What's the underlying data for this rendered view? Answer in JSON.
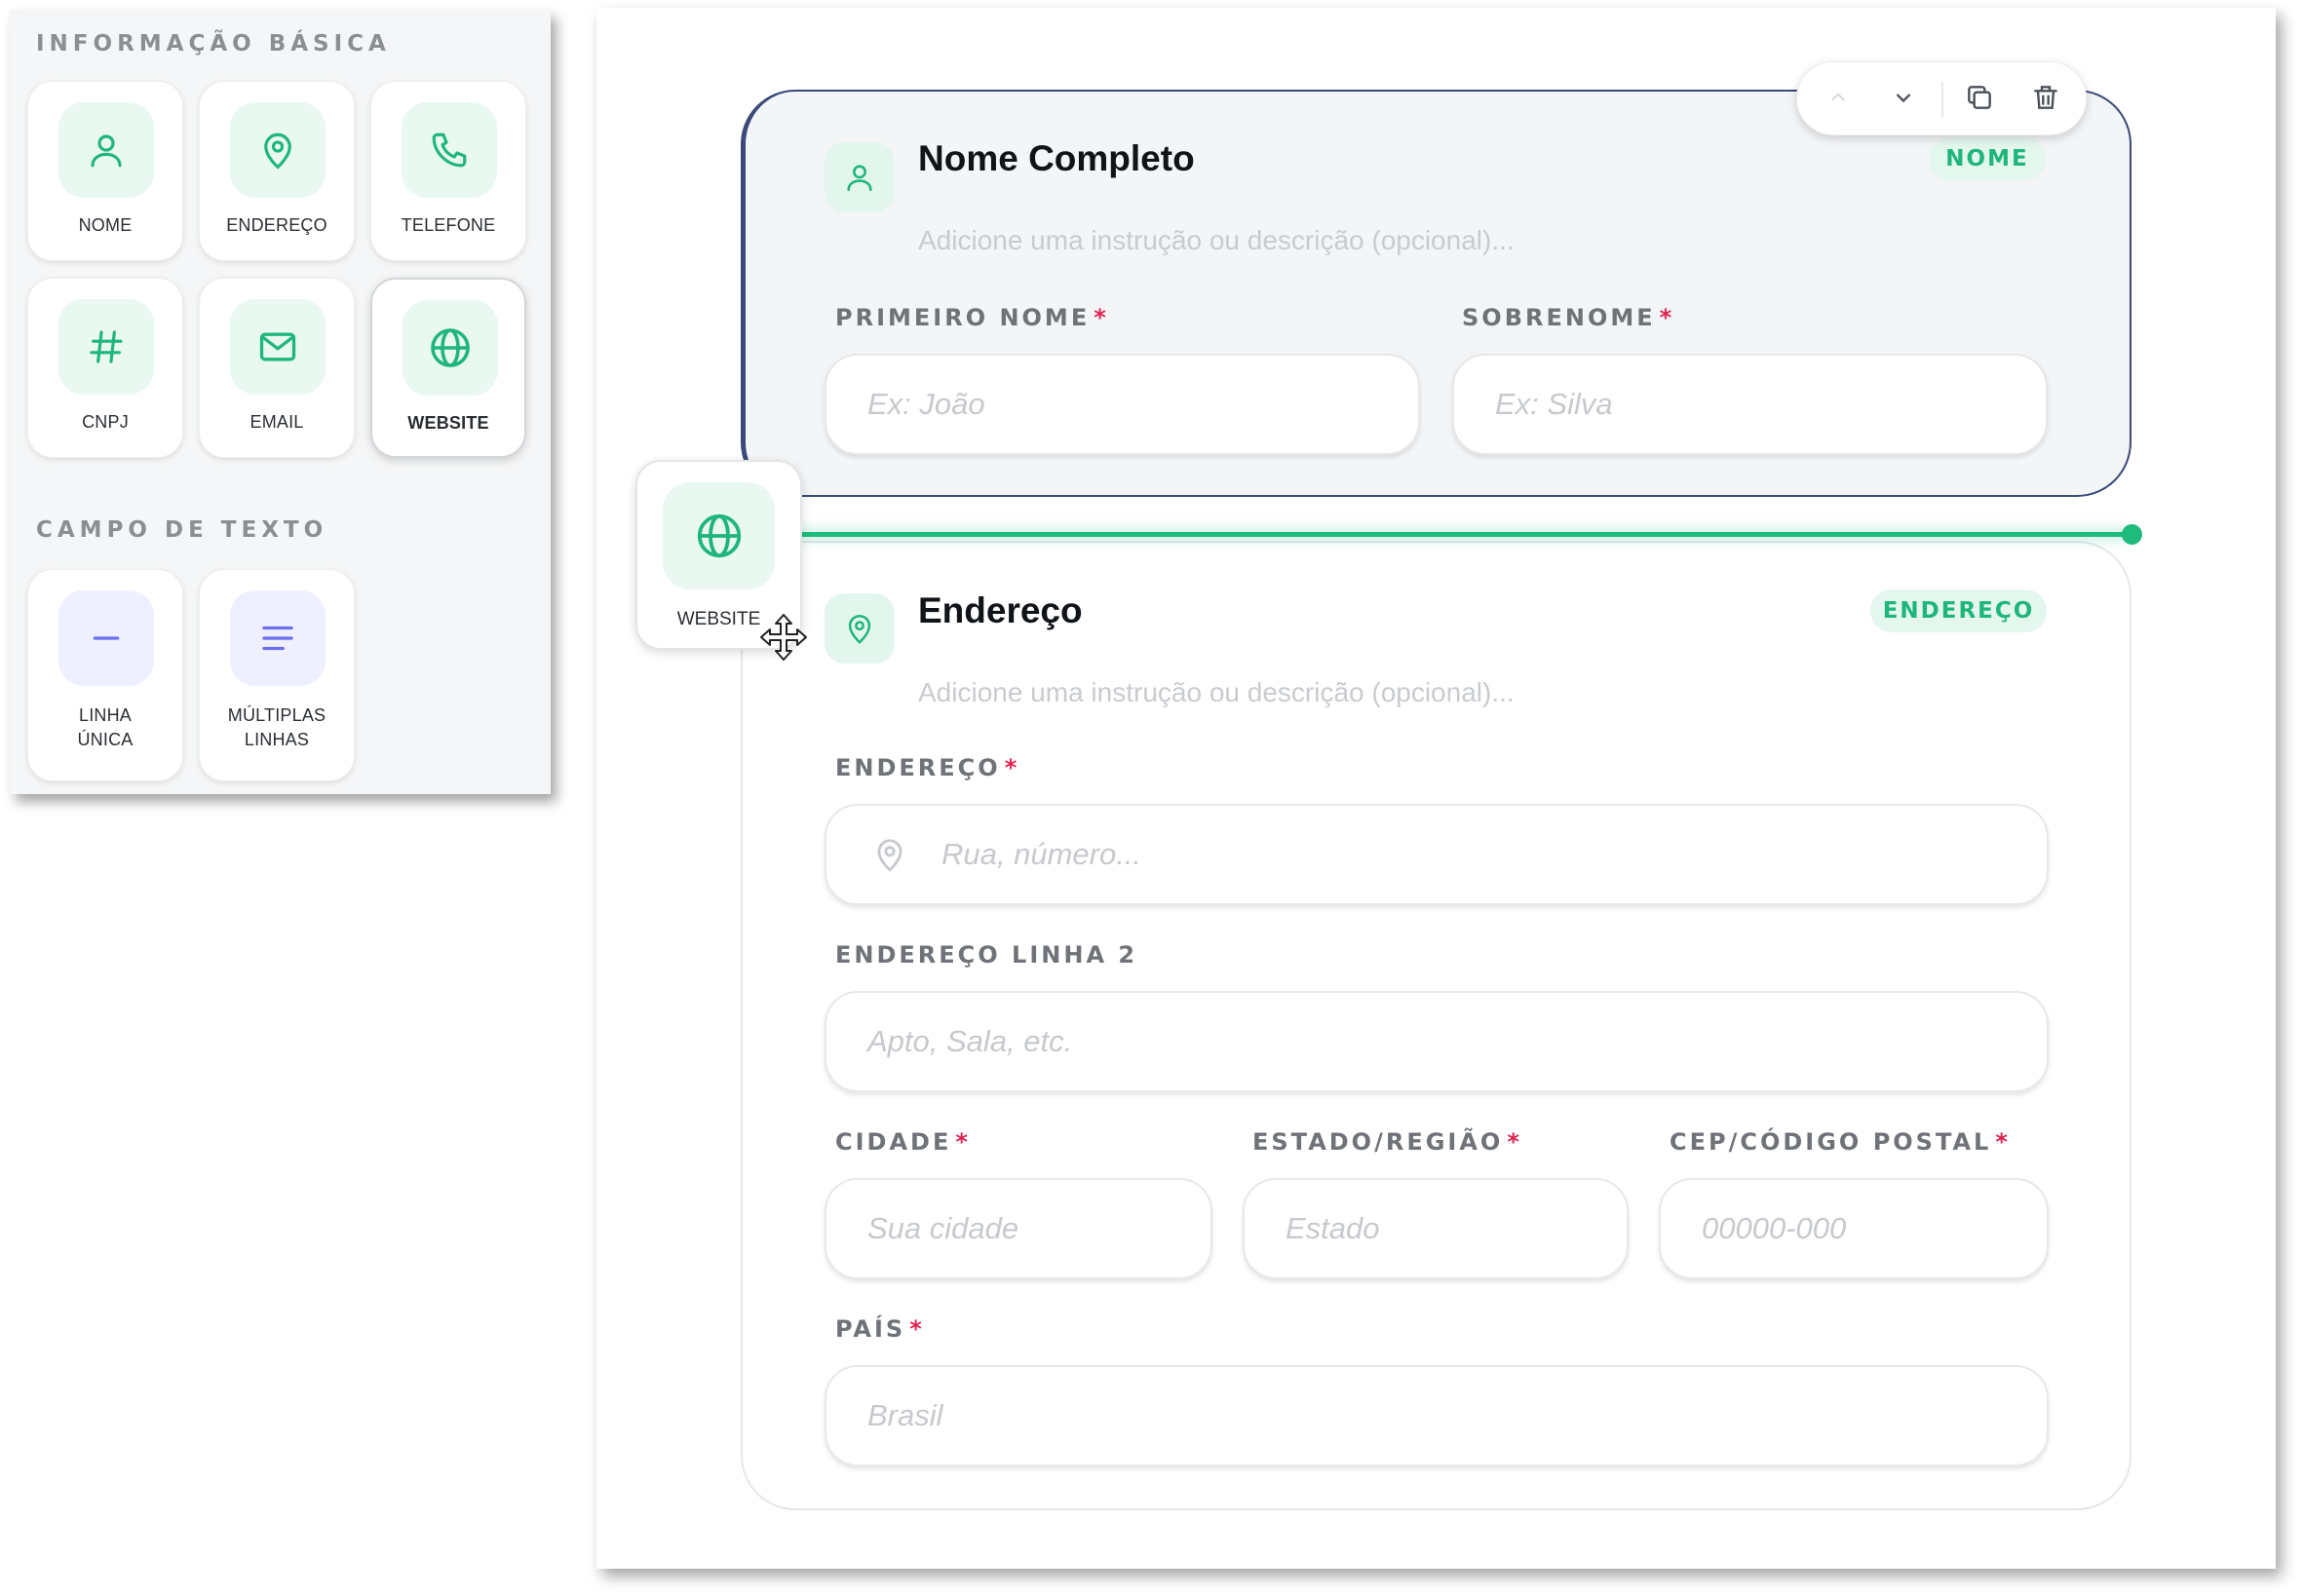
{
  "palette": {
    "basic_title": "INFORMAÇÃO BÁSICA",
    "text_title": "CAMPO DE TEXTO",
    "basic_items": [
      {
        "label": "NOME",
        "icon": "user-icon"
      },
      {
        "label": "ENDEREÇO",
        "icon": "map-pin-icon"
      },
      {
        "label": "TELEFONE",
        "icon": "phone-icon"
      },
      {
        "label": "CNPJ",
        "icon": "hash-icon"
      },
      {
        "label": "EMAIL",
        "icon": "mail-icon"
      },
      {
        "label": "WEBSITE",
        "icon": "globe-icon",
        "selected": true
      }
    ],
    "text_items": [
      {
        "label_line1": "LINHA",
        "label_line2": "ÚNICA",
        "icon": "minus-icon"
      },
      {
        "label_line1": "MÚLTIPLAS",
        "label_line2": "LINHAS",
        "icon": "align-left-icon"
      }
    ]
  },
  "toolbar": {
    "icons": [
      "chevron-up-icon",
      "chevron-down-icon",
      "copy-icon",
      "trash-icon"
    ]
  },
  "name_card": {
    "title": "Nome Completo",
    "badge": "NOME",
    "description_placeholder": "Adicione uma instrução ou descrição (opcional)...",
    "first_name": {
      "label": "PRIMEIRO NOME",
      "required": "*",
      "placeholder": "Ex: João"
    },
    "last_name": {
      "label": "SOBRENOME",
      "required": "*",
      "placeholder": "Ex: Silva"
    }
  },
  "address_card": {
    "title": "Endereço",
    "badge": "ENDEREÇO",
    "description_placeholder": "Adicione uma instrução ou descrição (opcional)...",
    "address": {
      "label": "ENDEREÇO",
      "required": "*",
      "placeholder": "Rua, número..."
    },
    "address2": {
      "label": "ENDEREÇO LINHA 2",
      "placeholder": "Apto, Sala, etc."
    },
    "city": {
      "label": "CIDADE",
      "required": "*",
      "placeholder": "Sua cidade"
    },
    "state": {
      "label": "ESTADO/REGIÃO",
      "required": "*",
      "placeholder": "Estado"
    },
    "zip": {
      "label": "CEP/CÓDIGO POSTAL",
      "required": "*",
      "placeholder": "00000-000"
    },
    "country": {
      "label": "PAÍS",
      "required": "*",
      "placeholder": "Brasil"
    }
  },
  "drag_ghost": {
    "label": "WEBSITE",
    "icon": "globe-icon"
  },
  "colors": {
    "accent": "#1fbb7d",
    "badge_bg": "#e3f7ee",
    "required": "#e0244f",
    "selected_border": "#3b4a7a"
  }
}
